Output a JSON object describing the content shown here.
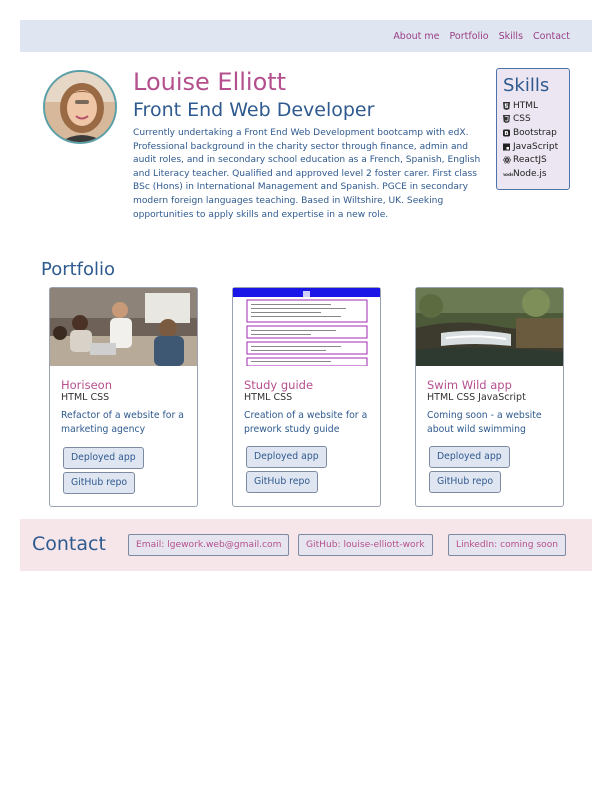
{
  "nav": {
    "links": [
      "About me",
      "Portfolio",
      "Skills",
      "Contact"
    ]
  },
  "profile": {
    "name": "Louise Elliott",
    "role": "Front End Web Developer",
    "bio": "Currently undertaking a Front End Web Development bootcamp with edX. Professional background in the charity sector through finance, admin and audit roles, and in secondary school education as a French, Spanish, English and Literacy teacher. Qualified and approved level 2 foster carer. First class BSc (Hons) in International Management and Spanish. PGCE in secondary modern foreign languages teaching. Based in Wiltshire, UK. Seeking opportunities to apply skills and expertise in a new role."
  },
  "skills": {
    "title": "Skills",
    "items": [
      {
        "label": "HTML",
        "icon": "html5-icon"
      },
      {
        "label": "CSS",
        "icon": "css3-icon"
      },
      {
        "label": "Bootstrap",
        "icon": "bootstrap-icon"
      },
      {
        "label": "JavaScript",
        "icon": "javascript-icon"
      },
      {
        "label": "ReactJS",
        "icon": "react-icon"
      },
      {
        "label": "Node.js",
        "icon": "nodejs-icon"
      }
    ]
  },
  "portfolio": {
    "title": "Portfolio",
    "projects": [
      {
        "title": "Horiseon",
        "tech": "HTML CSS",
        "description": "Refactor of a website for a marketing agency",
        "deployed_label": "Deployed app",
        "repo_label": "GitHub repo"
      },
      {
        "title": "Study guide",
        "tech": "HTML CSS",
        "description": "Creation of a website for a prework study guide",
        "deployed_label": "Deployed app",
        "repo_label": "GitHub repo"
      },
      {
        "title": "Swim Wild app",
        "tech": "HTML CSS JavaScript",
        "description": "Coming soon - a website about wild swimming",
        "deployed_label": "Deployed app",
        "repo_label": "GitHub repo"
      }
    ]
  },
  "contact": {
    "title": "Contact",
    "email": "Email: lgework.web@gmail.com",
    "github": "GitHub: louise-elliott-work",
    "linkedin": "LinkedIn: coming soon"
  },
  "colors": {
    "accent_pink": "#b5508e",
    "accent_blue": "#2f5a8f",
    "nav_bg": "#dfe6f1",
    "contact_bg": "#f6e6ea"
  }
}
